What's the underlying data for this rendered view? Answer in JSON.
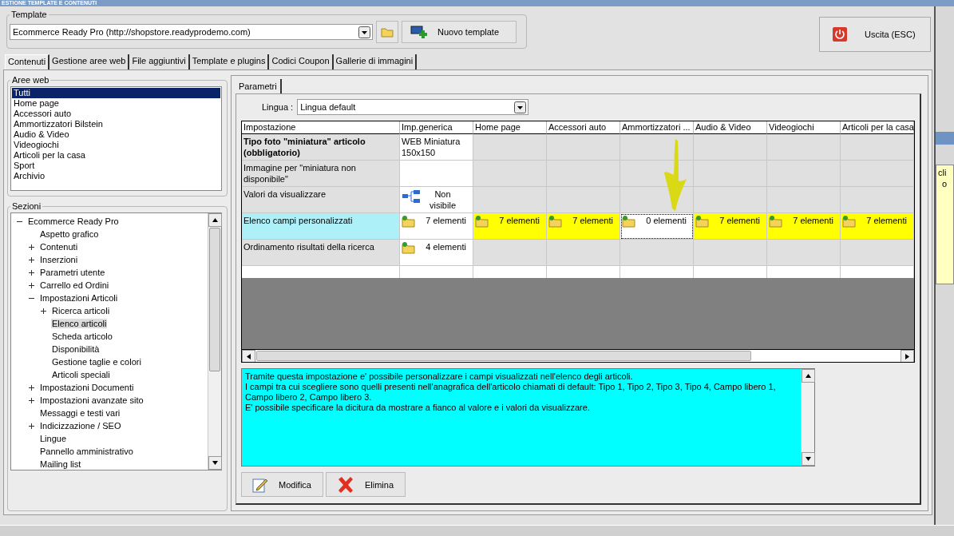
{
  "window": {
    "title": "ESTIONE TEMPLATE E CONTENUTI"
  },
  "template": {
    "label": "Template",
    "value": "Ecommerce Ready Pro (http://shopstore.readyprodemo.com)",
    "new_button": "Nuovo template"
  },
  "exit_button": "Uscita (ESC)",
  "tabs": [
    {
      "label": "Contenuti",
      "selected": true
    },
    {
      "label": "Gestione aree web",
      "selected": false
    },
    {
      "label": "File aggiuntivi",
      "selected": false
    },
    {
      "label": "Template e plugins",
      "selected": false
    },
    {
      "label": "Codici Coupon",
      "selected": false
    },
    {
      "label": "Gallerie di immagini",
      "selected": false
    }
  ],
  "web_areas": {
    "label": "Aree web",
    "items": [
      {
        "label": "Tutti",
        "selected": true
      },
      {
        "label": "Home page",
        "selected": false
      },
      {
        "label": "Accessori auto",
        "selected": false
      },
      {
        "label": "Ammortizzatori Bilstein",
        "selected": false
      },
      {
        "label": "Audio & Video",
        "selected": false
      },
      {
        "label": "Videogiochi",
        "selected": false
      },
      {
        "label": "Articoli per la casa",
        "selected": false
      },
      {
        "label": "Sport",
        "selected": false
      },
      {
        "label": "Archivio",
        "selected": false
      }
    ]
  },
  "sections": {
    "label": "Sezioni",
    "tree": [
      {
        "label": "Ecommerce Ready Pro",
        "kind": "folder",
        "expanded": true,
        "selected": false,
        "children": [
          {
            "label": "Aspetto grafico",
            "kind": "leaf",
            "selected": false
          },
          {
            "label": "Contenuti",
            "kind": "folder",
            "expanded": false,
            "selected": false
          },
          {
            "label": "Inserzioni",
            "kind": "folder",
            "expanded": false,
            "selected": false
          },
          {
            "label": "Parametri utente",
            "kind": "folder",
            "expanded": false,
            "selected": false
          },
          {
            "label": "Carrello ed Ordini",
            "kind": "folder",
            "expanded": false,
            "selected": false
          },
          {
            "label": "Impostazioni Articoli",
            "kind": "folder",
            "expanded": true,
            "selected": false,
            "children": [
              {
                "label": "Ricerca articoli",
                "kind": "folder",
                "expanded": false,
                "selected": false
              },
              {
                "label": "Elenco articoli",
                "kind": "leaf",
                "selected": true
              },
              {
                "label": "Scheda articolo",
                "kind": "leaf",
                "selected": false
              },
              {
                "label": "Disponibilità",
                "kind": "leaf",
                "selected": false
              },
              {
                "label": "Gestione taglie e colori",
                "kind": "leaf",
                "selected": false
              },
              {
                "label": "Articoli speciali",
                "kind": "leaf",
                "selected": false
              }
            ]
          },
          {
            "label": "Impostazioni Documenti",
            "kind": "folder",
            "expanded": false,
            "selected": false
          },
          {
            "label": "Impostazioni avanzate sito",
            "kind": "folder",
            "expanded": false,
            "selected": false
          },
          {
            "label": "Messaggi e testi vari",
            "kind": "leaf",
            "selected": false
          },
          {
            "label": "Indicizzazione / SEO",
            "kind": "folder",
            "expanded": false,
            "selected": false
          },
          {
            "label": "Lingue",
            "kind": "leaf",
            "selected": false
          },
          {
            "label": "Pannello amministrativo",
            "kind": "leaf",
            "selected": false
          },
          {
            "label": "Mailing list",
            "kind": "leaf",
            "selected": false
          }
        ]
      }
    ]
  },
  "params_tab": {
    "label": "Parametri",
    "selected": true
  },
  "language": {
    "label": "Lingua :",
    "value": "Lingua default"
  },
  "table": {
    "columns": [
      "Impostazione",
      "Imp.generica",
      "Home page",
      "Accessori auto",
      "Ammortizzatori ...",
      "Audio & Video",
      "Videogiochi",
      "Articoli per la casa"
    ],
    "rows": [
      {
        "selected": false,
        "cells": [
          {
            "kind": "label",
            "text": "Tipo foto \"miniatura\" articolo (obbligatorio)",
            "bold": true
          },
          {
            "kind": "text",
            "text": "WEB Miniatura 150x150"
          },
          {
            "kind": "empty"
          },
          {
            "kind": "empty"
          },
          {
            "kind": "empty"
          },
          {
            "kind": "empty"
          },
          {
            "kind": "empty"
          },
          {
            "kind": "empty"
          }
        ]
      },
      {
        "selected": false,
        "cells": [
          {
            "kind": "label",
            "text": "Immagine per \"miniatura non disponibile\"",
            "bold": false
          },
          {
            "kind": "blank"
          },
          {
            "kind": "empty"
          },
          {
            "kind": "empty"
          },
          {
            "kind": "empty"
          },
          {
            "kind": "empty"
          },
          {
            "kind": "empty"
          },
          {
            "kind": "empty"
          }
        ]
      },
      {
        "selected": false,
        "cells": [
          {
            "kind": "label",
            "text": "Valori da visualizzare",
            "bold": false
          },
          {
            "kind": "tree",
            "text": "Non visibile"
          },
          {
            "kind": "empty"
          },
          {
            "kind": "empty"
          },
          {
            "kind": "empty"
          },
          {
            "kind": "empty"
          },
          {
            "kind": "empty"
          },
          {
            "kind": "empty"
          }
        ]
      },
      {
        "selected": true,
        "cells": [
          {
            "kind": "label",
            "text": "Elenco campi personalizzati",
            "bold": false
          },
          {
            "kind": "folder",
            "text": "7 elementi",
            "highlighted": false,
            "focused": false
          },
          {
            "kind": "folder",
            "text": "7 elementi",
            "highlighted": true,
            "focused": false
          },
          {
            "kind": "folder",
            "text": "7 elementi",
            "highlighted": true,
            "focused": false
          },
          {
            "kind": "folder",
            "text": "0 elementi",
            "highlighted": false,
            "focused": true
          },
          {
            "kind": "folder",
            "text": "7 elementi",
            "highlighted": true,
            "focused": false
          },
          {
            "kind": "folder",
            "text": "7 elementi",
            "highlighted": true,
            "focused": false
          },
          {
            "kind": "folder",
            "text": "7 elementi",
            "highlighted": true,
            "focused": false
          }
        ]
      },
      {
        "selected": false,
        "cells": [
          {
            "kind": "label",
            "text": "Ordinamento risultati della ricerca",
            "bold": false
          },
          {
            "kind": "folder",
            "text": "4 elementi",
            "highlighted": false,
            "focused": false
          },
          {
            "kind": "empty"
          },
          {
            "kind": "empty"
          },
          {
            "kind": "empty"
          },
          {
            "kind": "empty"
          },
          {
            "kind": "empty"
          },
          {
            "kind": "empty"
          }
        ]
      }
    ]
  },
  "description": "Tramite questa impostazione e' possibile personalizzare i campi visualizzati nell'elenco degli articoli.\nI campi tra cui scegliere sono quelli presenti nell'anagrafica dell'articolo chiamati di default: Tipo 1, Tipo 2, Tipo 3, Tipo 4, Campo libero 1, Campo libero 2, Campo libero 3.\nE' possibile specificare la dicitura da mostrare a fianco al valore e i valori da visualizzare.",
  "buttons": [
    {
      "label": "Modifica",
      "kind": "edit"
    },
    {
      "label": "Elimina",
      "kind": "delete"
    }
  ],
  "background_window": {
    "texts": [
      "cli",
      "o"
    ]
  }
}
